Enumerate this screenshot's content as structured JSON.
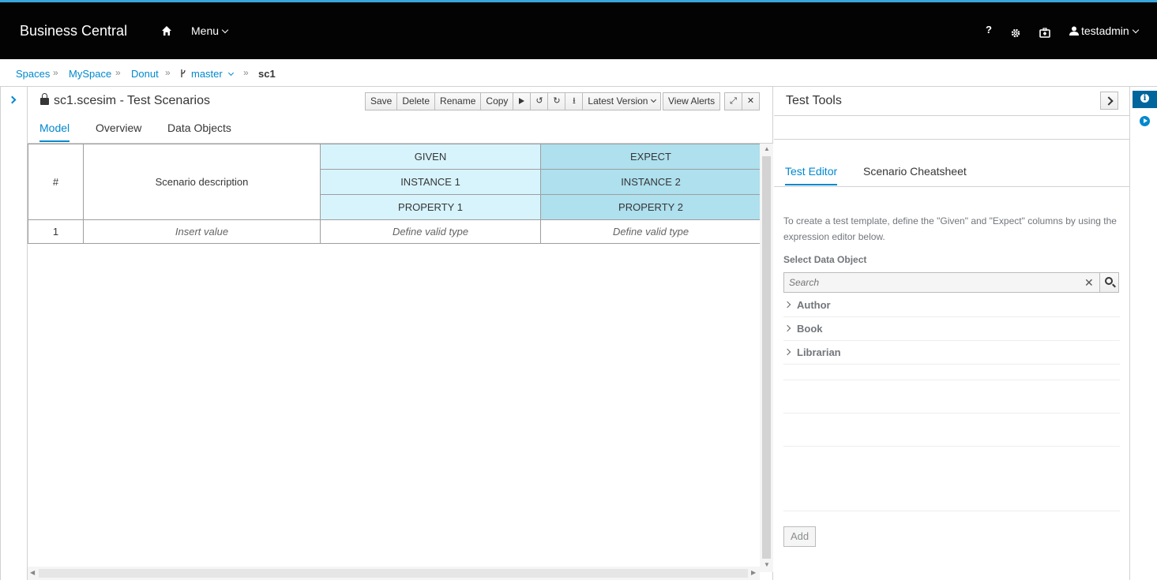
{
  "header": {
    "brand": "Business Central",
    "menu_label": "Menu",
    "help_label": "?",
    "username": "testadmin"
  },
  "breadcrumb": {
    "items": [
      "Spaces",
      "MySpace",
      "Donut",
      "master",
      "sc1"
    ],
    "separator": "»"
  },
  "editor": {
    "title": "sc1.scesim - Test Scenarios",
    "toolbar": {
      "save": "Save",
      "delete": "Delete",
      "rename": "Rename",
      "copy": "Copy",
      "latest_version": "Latest Version",
      "view_alerts": "View Alerts"
    },
    "tabs": [
      "Model",
      "Overview",
      "Data Objects"
    ],
    "active_tab": "Model",
    "grid": {
      "index_header": "#",
      "description_header": "Scenario description",
      "given_label": "GIVEN",
      "expect_label": "EXPECT",
      "given_instance": "INSTANCE 1",
      "expect_instance": "INSTANCE 2",
      "given_property": "PROPERTY 1",
      "expect_property": "PROPERTY 2",
      "rows": [
        {
          "index": "1",
          "description": "Insert value",
          "given": "Define valid type",
          "expect": "Define valid type"
        }
      ]
    }
  },
  "tools": {
    "title": "Test Tools",
    "tabs": [
      "Test Editor",
      "Scenario Cheatsheet"
    ],
    "active_tab": "Test Editor",
    "help_text": "To create a test template, define the \"Given\" and \"Expect\" columns by using the expression editor below.",
    "select_label": "Select Data Object",
    "search_placeholder": "Search",
    "data_objects": [
      "Author",
      "Book",
      "Librarian"
    ],
    "add_label": "Add"
  },
  "colors": {
    "accent": "#0088ce",
    "header_bg": "#030303",
    "given_bg": "#d7f4fd",
    "expect_bg": "#aee0ee"
  }
}
